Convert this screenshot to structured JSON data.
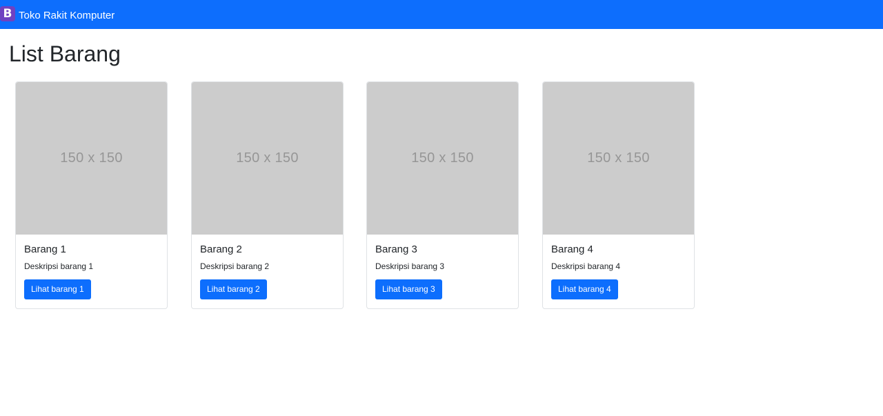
{
  "navbar": {
    "logo_letter": "B",
    "brand": "Toko Rakit Komputer"
  },
  "page": {
    "title": "List Barang"
  },
  "cards": [
    {
      "image_text": "150 x 150",
      "title": "Barang 1",
      "description": "Deskripsi barang 1",
      "button": "Lihat barang 1"
    },
    {
      "image_text": "150 x 150",
      "title": "Barang 2",
      "description": "Deskripsi barang 2",
      "button": "Lihat barang 2"
    },
    {
      "image_text": "150 x 150",
      "title": "Barang 3",
      "description": "Deskripsi barang 3",
      "button": "Lihat barang 3"
    },
    {
      "image_text": "150 x 150",
      "title": "Barang 4",
      "description": "Deskripsi barang 4",
      "button": "Lihat barang 4"
    }
  ],
  "colors": {
    "primary": "#0d6efd",
    "logo": "#6f42c1",
    "placeholder": "#cccccc"
  }
}
